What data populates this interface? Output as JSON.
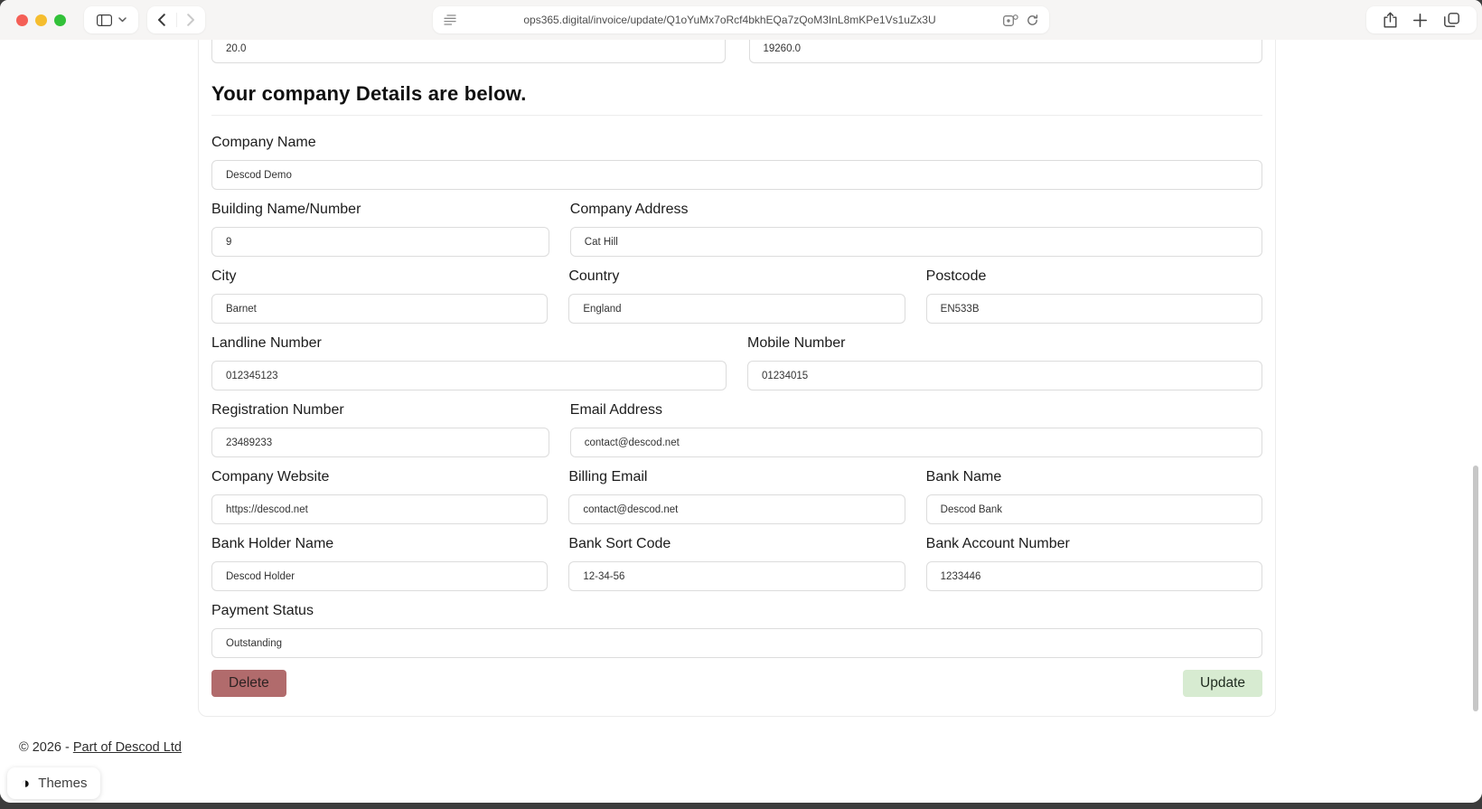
{
  "window": {
    "traffic_lights": [
      "#f45f56",
      "#f5bd2e",
      "#32c139"
    ],
    "toolbar": {
      "url": "ops365.digital/invoice/update/Q1oYuMx7oRcf4bkhEQa7zQoM3InL8mKPe1Vs1uZx3U"
    }
  },
  "page": {
    "top_partial_fields": [
      {
        "name": "partial-left",
        "value": "20.0"
      },
      {
        "name": "partial-right",
        "value": "19260.0"
      }
    ],
    "form": {
      "heading": "Your company Details are below.",
      "rows": [
        {
          "cols": [
            {
              "name": "company-name",
              "label": "Company Name",
              "value": "Descod Demo",
              "flex": 1
            }
          ]
        },
        {
          "cols": [
            {
              "name": "building-name-number",
              "label": "Building Name/Number",
              "value": "9",
              "flex": 1
            },
            {
              "name": "company-address",
              "label": "Company Address",
              "value": "Cat Hill",
              "flex": 2.05
            }
          ]
        },
        {
          "cols": [
            {
              "name": "city",
              "label": "City",
              "value": "Barnet",
              "flex": 1
            },
            {
              "name": "country",
              "label": "Country",
              "value": "England",
              "flex": 1
            },
            {
              "name": "postcode",
              "label": "Postcode",
              "value": "EN533B",
              "flex": 1
            }
          ]
        },
        {
          "cols": [
            {
              "name": "landline-number",
              "label": "Landline Number",
              "value": "012345123",
              "flex": 1
            },
            {
              "name": "mobile-number",
              "label": "Mobile Number",
              "value": "01234015",
              "flex": 1
            }
          ]
        },
        {
          "cols": [
            {
              "name": "registration-number",
              "label": "Registration Number",
              "value": "23489233",
              "flex": 1
            },
            {
              "name": "email-address",
              "label": "Email Address",
              "value": "contact@descod.net",
              "flex": 2.05
            }
          ]
        },
        {
          "cols": [
            {
              "name": "company-website",
              "label": "Company Website",
              "value": "https://descod.net",
              "flex": 1
            },
            {
              "name": "billing-email",
              "label": "Billing Email",
              "value": "contact@descod.net",
              "flex": 1
            },
            {
              "name": "bank-name",
              "label": "Bank Name",
              "value": "Descod Bank",
              "flex": 1
            }
          ]
        },
        {
          "cols": [
            {
              "name": "bank-holder-name",
              "label": "Bank Holder Name",
              "value": "Descod Holder",
              "flex": 1
            },
            {
              "name": "bank-sort-code",
              "label": "Bank Sort Code",
              "value": "12-34-56",
              "flex": 1
            },
            {
              "name": "bank-account-number",
              "label": "Bank Account Number",
              "value": "1233446",
              "flex": 1
            }
          ]
        },
        {
          "cols": [
            {
              "name": "payment-status",
              "label": "Payment Status",
              "value": "Outstanding",
              "flex": 1
            }
          ]
        }
      ]
    },
    "actions": {
      "delete": "Delete",
      "update": "Update"
    },
    "footer": {
      "copyright_prefix": "© 2026 -",
      "link_text": "Part of Descod Ltd"
    },
    "theme_toggle": {
      "label": "Themes",
      "icon": "◑"
    }
  },
  "colors": {
    "delete_bg": "#b16b6c",
    "update_bg": "#d7ebd1",
    "toolbar_bg": "#f6f5f4"
  }
}
